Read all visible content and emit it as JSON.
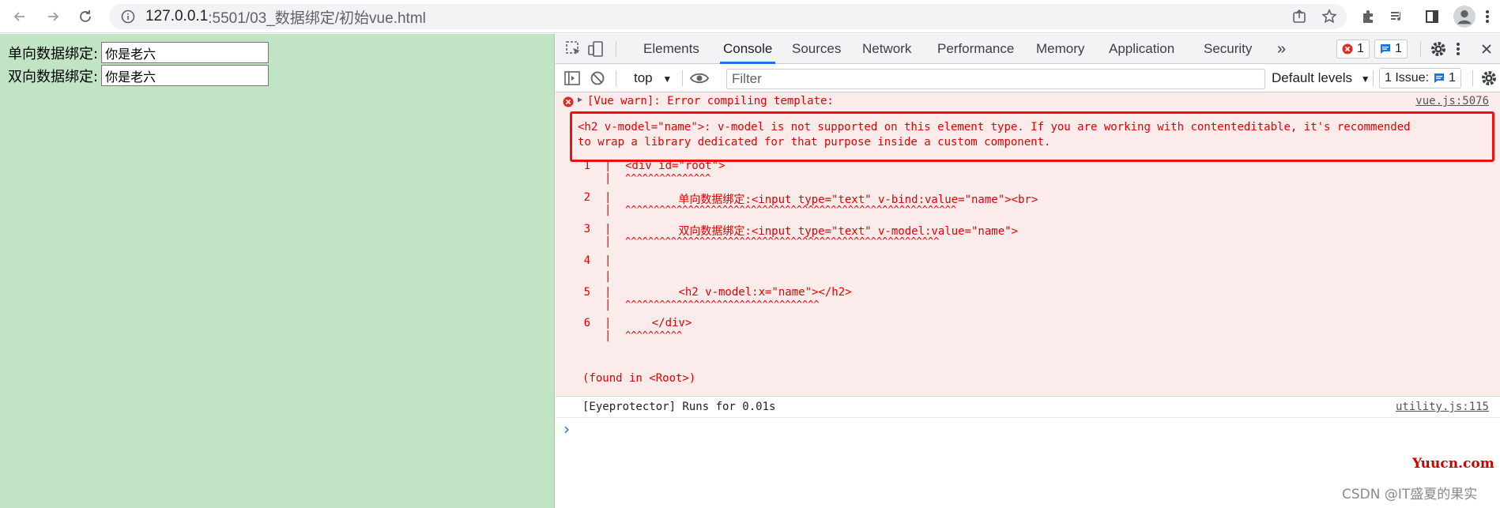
{
  "browser": {
    "url_host": "127.0.0.1",
    "url_path": ":5501/03_数据绑定/初始vue.html"
  },
  "page": {
    "one_way_label": "单向数据绑定:",
    "one_way_value": "你是老六",
    "two_way_label": "双向数据绑定:",
    "two_way_value": "你是老六"
  },
  "devtools": {
    "tabs": [
      "Elements",
      "Console",
      "Sources",
      "Network",
      "Performance",
      "Memory",
      "Application",
      "Security"
    ],
    "more_tabs": "»",
    "error_count": "1",
    "message_count": "1",
    "context": "top",
    "filter_placeholder": "Filter",
    "levels": "Default levels",
    "issues_label": "1 Issue:",
    "issues_count": "1"
  },
  "console": {
    "warn_header": "[Vue warn]: Error compiling template:",
    "warn_source": "vue.js:5076",
    "warn_msg_1": "<h2 v-model=\"name\">: v-model is not supported on this element type. If you are working with contenteditable, it's recommended",
    "warn_msg_2": "to wrap a library dedicated for that purpose inside a custom component.",
    "code_lines": [
      {
        "num": "1",
        "code": "<div id=\"root\">",
        "caret": "^^^^^^^^^^^^^^^"
      },
      {
        "num": "2",
        "code": "        单向数据绑定:<input type=\"text\" v-bind:value=\"name\"><br>",
        "caret": "^^^^^^^^^^^^^^^^^^^^^^^^^^^^^^^^^^^^^^^^^^^^^^^^^^^^^^^^^^"
      },
      {
        "num": "3",
        "code": "        双向数据绑定:<input type=\"text\" v-model:value=\"name\">",
        "caret": "^^^^^^^^^^^^^^^^^^^^^^^^^^^^^^^^^^^^^^^^^^^^^^^^^^^^^^^"
      },
      {
        "num": "4",
        "code": "",
        "caret": ""
      },
      {
        "num": "5",
        "code": "        <h2 v-model:x=\"name\"></h2>",
        "caret": "^^^^^^^^^^^^^^^^^^^^^^^^^^^^^^^^^^"
      },
      {
        "num": "6",
        "code": "    </div>",
        "caret": "^^^^^^^^^^"
      }
    ],
    "found_in": "(found in <Root>)",
    "log_msg": "[Eyeprotector] Runs for 0.01s",
    "log_source": "utility.js:115",
    "prompt": "›"
  },
  "watermark": {
    "site": "Yuucn.com",
    "author": "CSDN @IT盛夏的果实"
  }
}
